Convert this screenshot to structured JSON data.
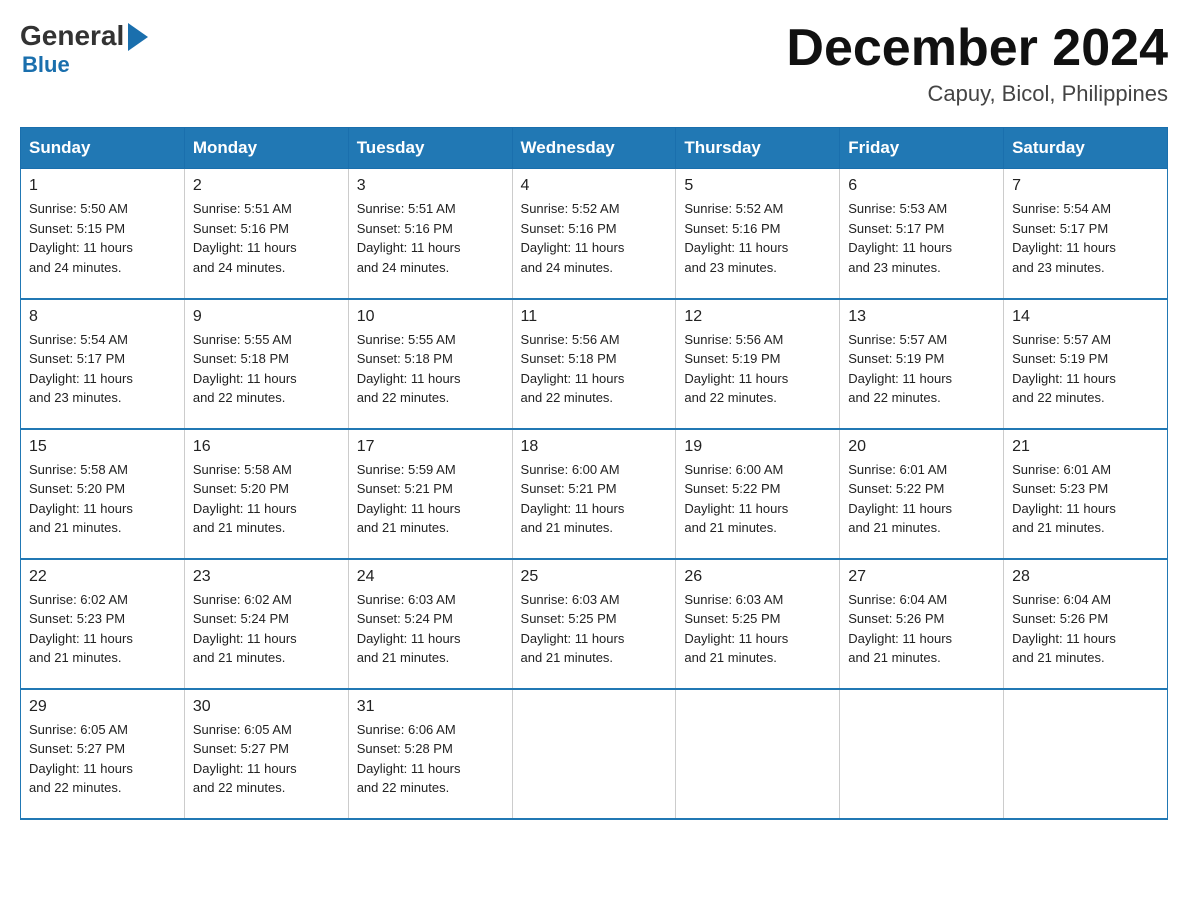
{
  "logo": {
    "general": "General",
    "arrow": "▶",
    "blue": "Blue"
  },
  "header": {
    "month": "December 2024",
    "location": "Capuy, Bicol, Philippines"
  },
  "weekdays": [
    "Sunday",
    "Monday",
    "Tuesday",
    "Wednesday",
    "Thursday",
    "Friday",
    "Saturday"
  ],
  "weeks": [
    [
      {
        "day": "1",
        "sunrise": "5:50 AM",
        "sunset": "5:15 PM",
        "daylight": "11 hours and 24 minutes."
      },
      {
        "day": "2",
        "sunrise": "5:51 AM",
        "sunset": "5:16 PM",
        "daylight": "11 hours and 24 minutes."
      },
      {
        "day": "3",
        "sunrise": "5:51 AM",
        "sunset": "5:16 PM",
        "daylight": "11 hours and 24 minutes."
      },
      {
        "day": "4",
        "sunrise": "5:52 AM",
        "sunset": "5:16 PM",
        "daylight": "11 hours and 24 minutes."
      },
      {
        "day": "5",
        "sunrise": "5:52 AM",
        "sunset": "5:16 PM",
        "daylight": "11 hours and 23 minutes."
      },
      {
        "day": "6",
        "sunrise": "5:53 AM",
        "sunset": "5:17 PM",
        "daylight": "11 hours and 23 minutes."
      },
      {
        "day": "7",
        "sunrise": "5:54 AM",
        "sunset": "5:17 PM",
        "daylight": "11 hours and 23 minutes."
      }
    ],
    [
      {
        "day": "8",
        "sunrise": "5:54 AM",
        "sunset": "5:17 PM",
        "daylight": "11 hours and 23 minutes."
      },
      {
        "day": "9",
        "sunrise": "5:55 AM",
        "sunset": "5:18 PM",
        "daylight": "11 hours and 22 minutes."
      },
      {
        "day": "10",
        "sunrise": "5:55 AM",
        "sunset": "5:18 PM",
        "daylight": "11 hours and 22 minutes."
      },
      {
        "day": "11",
        "sunrise": "5:56 AM",
        "sunset": "5:18 PM",
        "daylight": "11 hours and 22 minutes."
      },
      {
        "day": "12",
        "sunrise": "5:56 AM",
        "sunset": "5:19 PM",
        "daylight": "11 hours and 22 minutes."
      },
      {
        "day": "13",
        "sunrise": "5:57 AM",
        "sunset": "5:19 PM",
        "daylight": "11 hours and 22 minutes."
      },
      {
        "day": "14",
        "sunrise": "5:57 AM",
        "sunset": "5:19 PM",
        "daylight": "11 hours and 22 minutes."
      }
    ],
    [
      {
        "day": "15",
        "sunrise": "5:58 AM",
        "sunset": "5:20 PM",
        "daylight": "11 hours and 21 minutes."
      },
      {
        "day": "16",
        "sunrise": "5:58 AM",
        "sunset": "5:20 PM",
        "daylight": "11 hours and 21 minutes."
      },
      {
        "day": "17",
        "sunrise": "5:59 AM",
        "sunset": "5:21 PM",
        "daylight": "11 hours and 21 minutes."
      },
      {
        "day": "18",
        "sunrise": "6:00 AM",
        "sunset": "5:21 PM",
        "daylight": "11 hours and 21 minutes."
      },
      {
        "day": "19",
        "sunrise": "6:00 AM",
        "sunset": "5:22 PM",
        "daylight": "11 hours and 21 minutes."
      },
      {
        "day": "20",
        "sunrise": "6:01 AM",
        "sunset": "5:22 PM",
        "daylight": "11 hours and 21 minutes."
      },
      {
        "day": "21",
        "sunrise": "6:01 AM",
        "sunset": "5:23 PM",
        "daylight": "11 hours and 21 minutes."
      }
    ],
    [
      {
        "day": "22",
        "sunrise": "6:02 AM",
        "sunset": "5:23 PM",
        "daylight": "11 hours and 21 minutes."
      },
      {
        "day": "23",
        "sunrise": "6:02 AM",
        "sunset": "5:24 PM",
        "daylight": "11 hours and 21 minutes."
      },
      {
        "day": "24",
        "sunrise": "6:03 AM",
        "sunset": "5:24 PM",
        "daylight": "11 hours and 21 minutes."
      },
      {
        "day": "25",
        "sunrise": "6:03 AM",
        "sunset": "5:25 PM",
        "daylight": "11 hours and 21 minutes."
      },
      {
        "day": "26",
        "sunrise": "6:03 AM",
        "sunset": "5:25 PM",
        "daylight": "11 hours and 21 minutes."
      },
      {
        "day": "27",
        "sunrise": "6:04 AM",
        "sunset": "5:26 PM",
        "daylight": "11 hours and 21 minutes."
      },
      {
        "day": "28",
        "sunrise": "6:04 AM",
        "sunset": "5:26 PM",
        "daylight": "11 hours and 21 minutes."
      }
    ],
    [
      {
        "day": "29",
        "sunrise": "6:05 AM",
        "sunset": "5:27 PM",
        "daylight": "11 hours and 22 minutes."
      },
      {
        "day": "30",
        "sunrise": "6:05 AM",
        "sunset": "5:27 PM",
        "daylight": "11 hours and 22 minutes."
      },
      {
        "day": "31",
        "sunrise": "6:06 AM",
        "sunset": "5:28 PM",
        "daylight": "11 hours and 22 minutes."
      },
      null,
      null,
      null,
      null
    ]
  ],
  "labels": {
    "sunrise": "Sunrise:",
    "sunset": "Sunset:",
    "daylight": "Daylight:"
  }
}
